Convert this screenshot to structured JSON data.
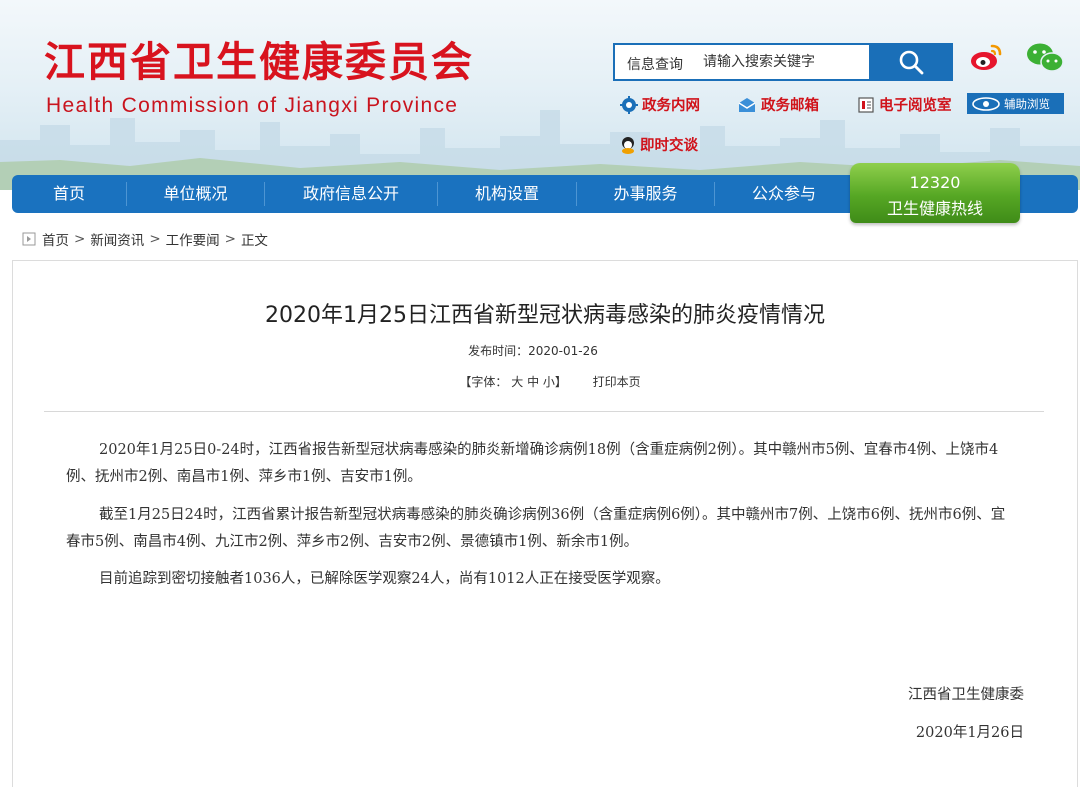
{
  "header": {
    "title": "江西省卫生健康委员会",
    "subtitle": "Health Commission of Jiangxi Province",
    "search": {
      "label": "信息查询",
      "placeholder": "请输入搜索关键字"
    },
    "links": [
      {
        "label": "政务内网",
        "icon": "gear-globe-icon"
      },
      {
        "label": "政务邮箱",
        "icon": "mail-icon"
      },
      {
        "label": "电子阅览室",
        "icon": "book-icon"
      },
      {
        "label": "即时交谈",
        "icon": "chat-person-icon"
      }
    ],
    "assist_label": "辅助浏览",
    "social": [
      "weibo-icon",
      "wechat-icon"
    ]
  },
  "nav": {
    "items": [
      "首页",
      "单位概况",
      "政府信息公开",
      "机构设置",
      "办事服务",
      "公众参与"
    ],
    "hotline": {
      "number": "12320",
      "label": "卫生健康热线"
    }
  },
  "breadcrumb": [
    "首页",
    "新闻资讯",
    "工作要闻",
    "正文"
  ],
  "article": {
    "title": "2020年1月25日江西省新型冠状病毒感染的肺炎疫情情况",
    "date_label": "发布时间：",
    "date": "2020-01-26",
    "font_label": "【字体：",
    "font_large": "大",
    "font_medium": "中",
    "font_small": "小】",
    "print_label": "打印本页",
    "paragraphs": [
      "2020年1月25日0-24时，江西省报告新型冠状病毒感染的肺炎新增确诊病例18例（含重症病例2例）。其中赣州市5例、宜春市4例、上饶市4例、抚州市2例、南昌市1例、萍乡市1例、吉安市1例。",
      "截至1月25日24时，江西省累计报告新型冠状病毒感染的肺炎确诊病例36例（含重症病例6例）。其中赣州市7例、上饶市6例、抚州市6例、宜春市5例、南昌市4例、九江市2例、萍乡市2例、吉安市2例、景德镇市1例、新余市1例。",
      "目前追踪到密切接触者1036人，已解除医学观察24人，尚有1012人正在接受医学观察。"
    ],
    "signature": "江西省卫生健康委",
    "sign_date": "2020年1月26日"
  },
  "colors": {
    "brand_red": "#d8131e",
    "nav_blue": "#1a72bf",
    "hotline_green": "#56a724"
  }
}
